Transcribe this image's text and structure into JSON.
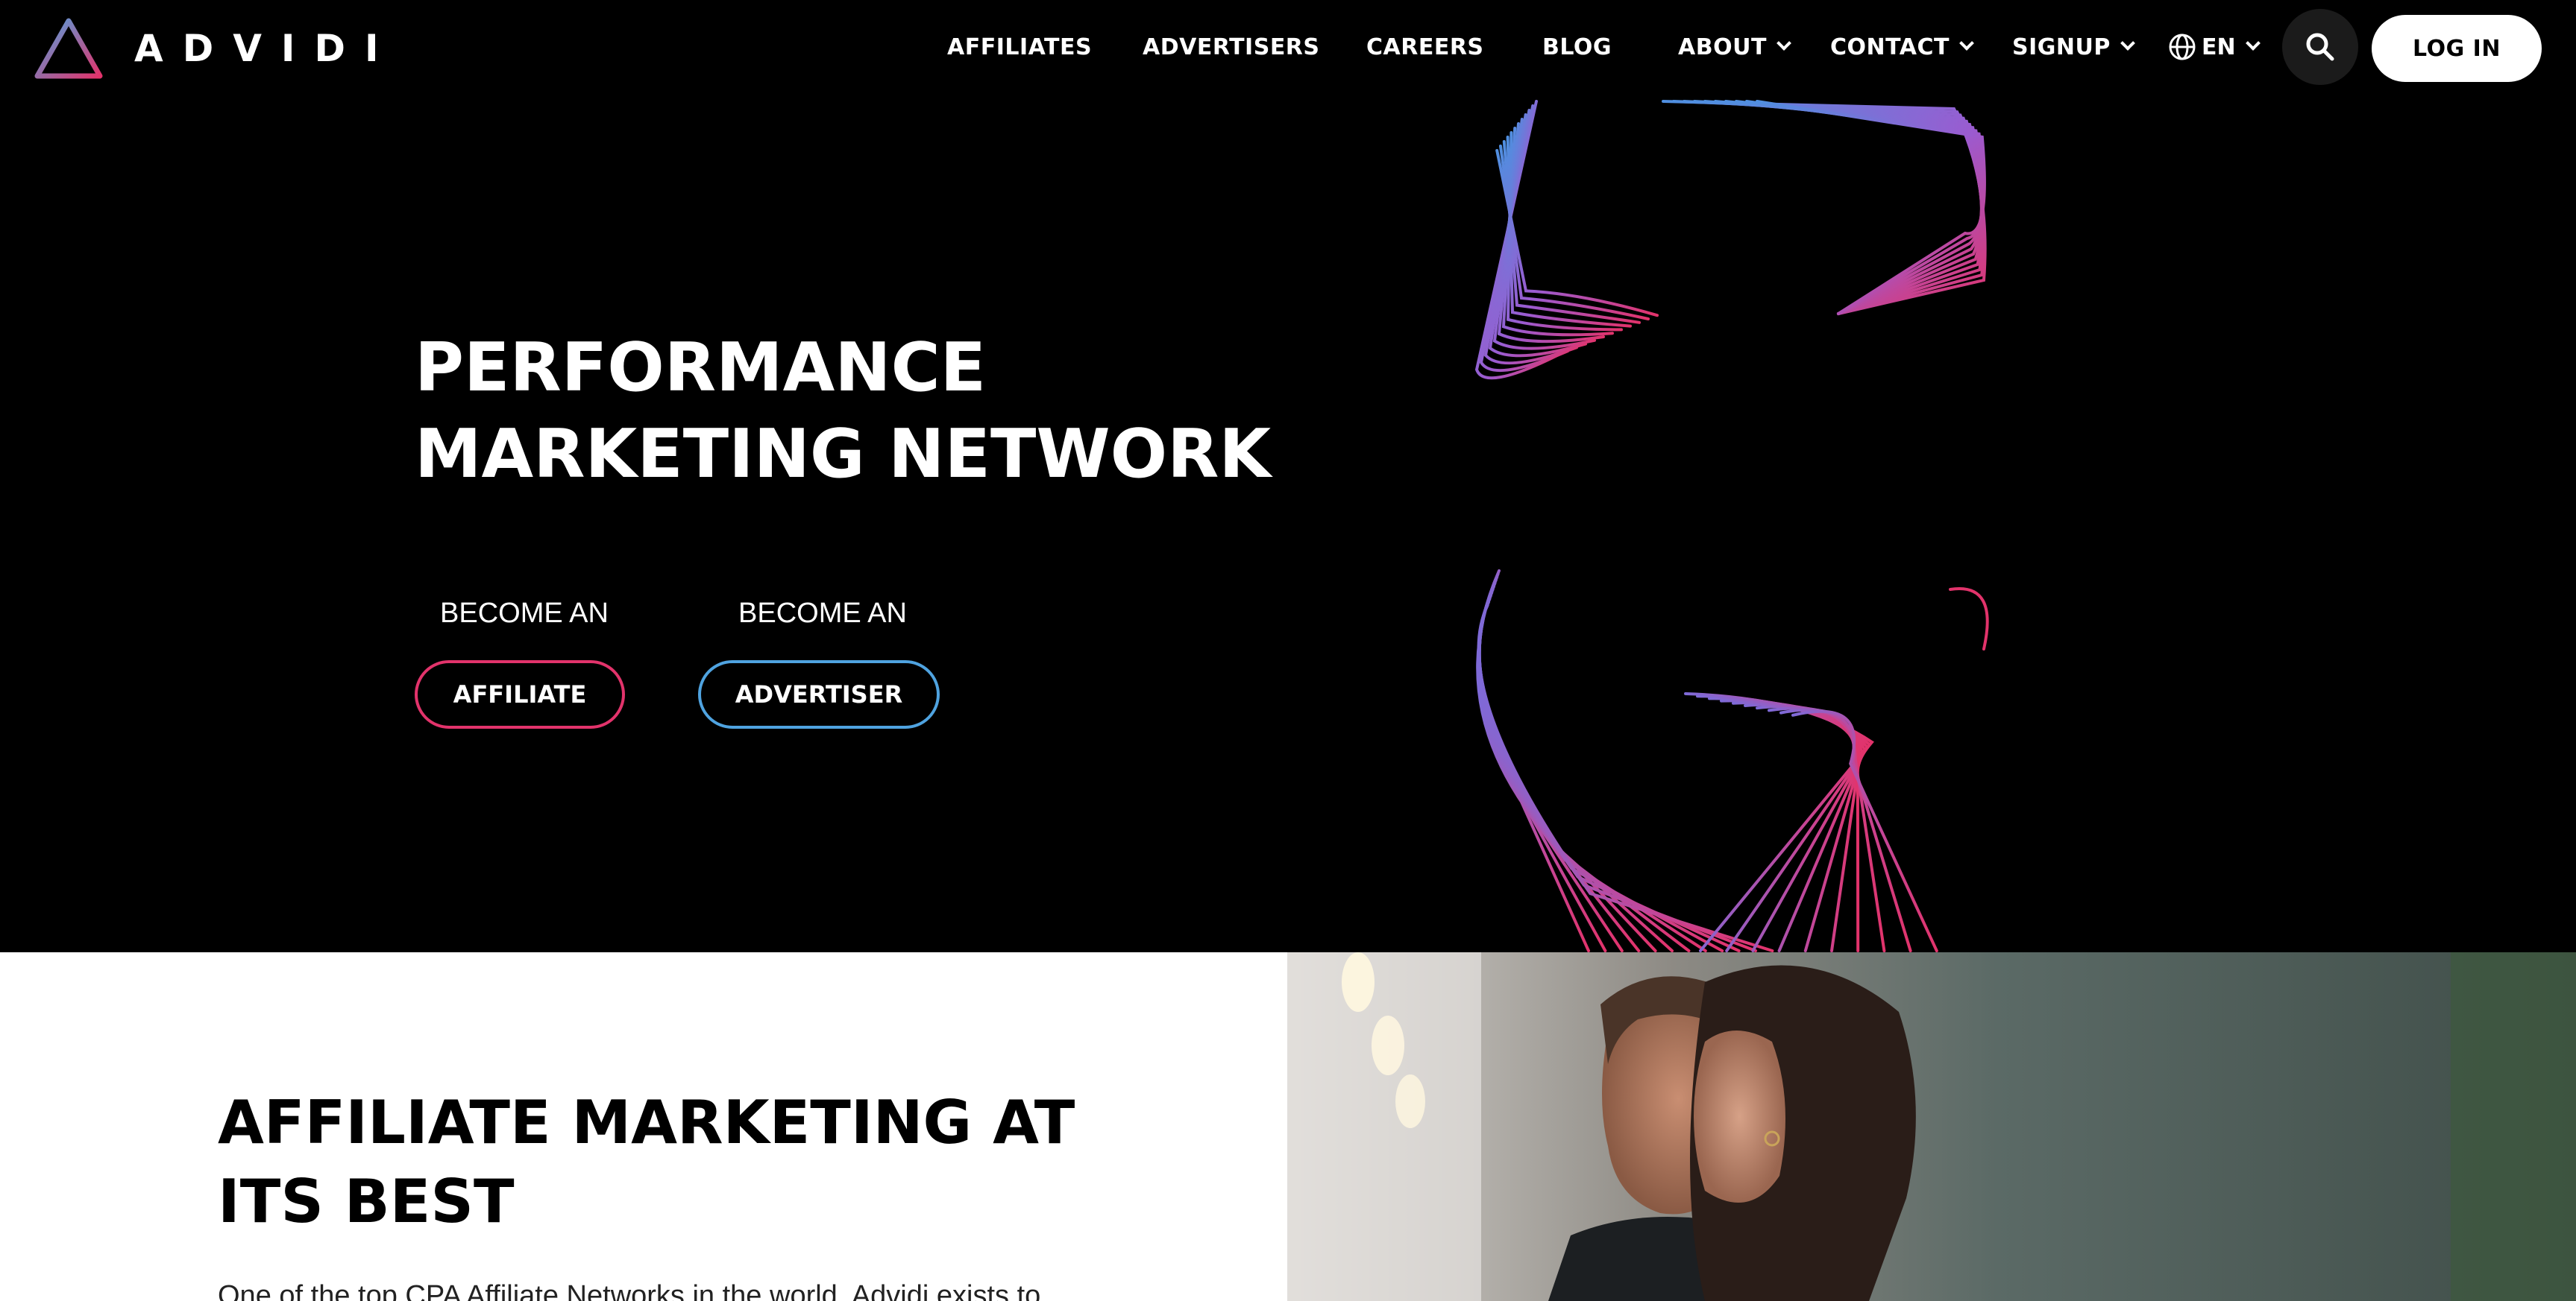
{
  "brand": {
    "name": "ADVIDI"
  },
  "nav": {
    "items": [
      {
        "label": "AFFILIATES",
        "dropdown": false
      },
      {
        "label": "ADVERTISERS",
        "dropdown": false
      },
      {
        "label": "CAREERS",
        "dropdown": false
      },
      {
        "label": "BLOG",
        "dropdown": false
      },
      {
        "label": "ABOUT",
        "dropdown": true
      },
      {
        "label": "CONTACT",
        "dropdown": true
      },
      {
        "label": "SIGNUP",
        "dropdown": true
      }
    ],
    "language": "EN",
    "login_label": "LOG IN",
    "icons": {
      "language": "globe-icon",
      "search": "search-icon",
      "dropdown": "chevron-down-icon"
    }
  },
  "hero": {
    "title_line1": "PERFORMANCE",
    "title_line2": "MARKETING NETWORK",
    "affiliate_prefix": "BECOME AN",
    "affiliate_button": "AFFILIATE",
    "advertiser_prefix": "BECOME AN",
    "advertiser_button": "ADVERTISER"
  },
  "section": {
    "title": "AFFILIATE MARKETING AT ITS BEST",
    "text": "One of the top CPA Affiliate Networks in the world. Advidi exists to"
  },
  "colors": {
    "background": "#000000",
    "affiliate_accent": "#e2336b",
    "advertiser_accent": "#4fa3e0",
    "logo_gradient_start": "#4fa3e0",
    "logo_gradient_end": "#e2336b"
  }
}
